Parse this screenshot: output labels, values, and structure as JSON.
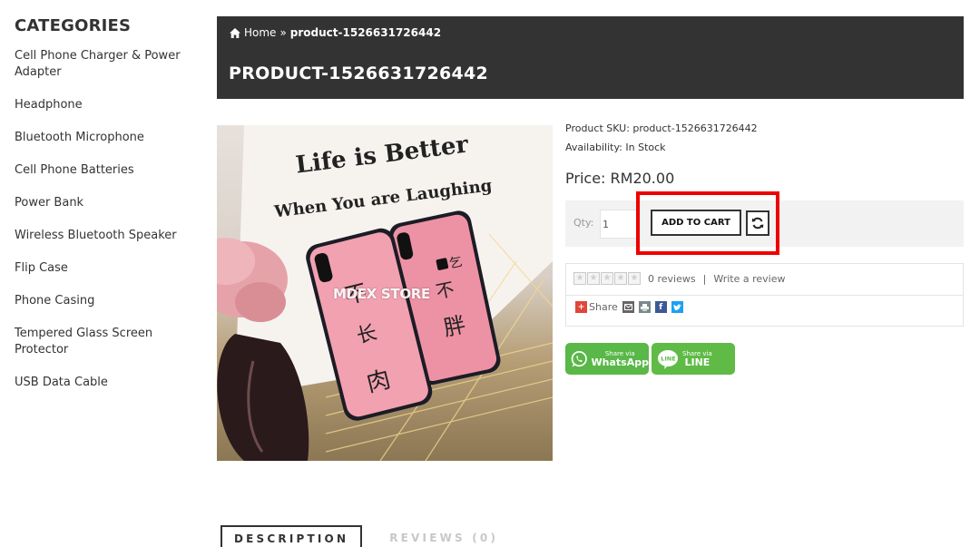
{
  "sidebar": {
    "title": "CATEGORIES",
    "items": [
      {
        "label": "Cell Phone Charger & Power Adapter"
      },
      {
        "label": "Headphone"
      },
      {
        "label": "Bluetooth Microphone"
      },
      {
        "label": "Cell Phone Batteries"
      },
      {
        "label": "Power Bank"
      },
      {
        "label": "Wireless Bluetooth Speaker"
      },
      {
        "label": "Flip Case"
      },
      {
        "label": "Phone Casing"
      },
      {
        "label": "Tempered Glass Screen Protector"
      },
      {
        "label": "USB Data Cable"
      }
    ]
  },
  "header": {
    "breadcrumb": {
      "home": "Home",
      "separator": "»",
      "current": "product-1526631726442",
      "icon": "home-icon"
    },
    "title": "PRODUCT-1526631726442"
  },
  "product": {
    "image": {
      "watermark": "MDEX STORE",
      "text_line1": "Life is Better",
      "text_line2": "When You are Laughing"
    },
    "sku_label": "Product SKU:",
    "sku": "product-1526631726442",
    "availability_label": "Availability:",
    "availability": "In Stock",
    "price_label": "Price:",
    "price": "RM20.00"
  },
  "cart": {
    "qty_label": "Qty:",
    "qty_value": "1",
    "add_to_cart": "ADD TO CART",
    "refresh_icon": "refresh-icon",
    "highlight_color": "#ef0000"
  },
  "reviews": {
    "rating": 0,
    "max_rating": 5,
    "count_text": "0 reviews",
    "separator": "|",
    "write_review": "Write a review"
  },
  "share": {
    "label": "Share",
    "icons": [
      "plus-share-icon",
      "email-icon",
      "print-icon",
      "facebook-icon",
      "twitter-icon"
    ],
    "whatsapp": {
      "small": "Share via",
      "big": "WhatsApp",
      "color": "#59b848"
    },
    "line": {
      "small": "Share via",
      "big": "LINE",
      "color": "#5fbb46"
    }
  },
  "tabs": [
    {
      "label": "DESCRIPTION"
    },
    {
      "label": "REVIEWS (0)"
    }
  ],
  "colors": {
    "header_bg": "#333333",
    "accent": "#333333"
  }
}
